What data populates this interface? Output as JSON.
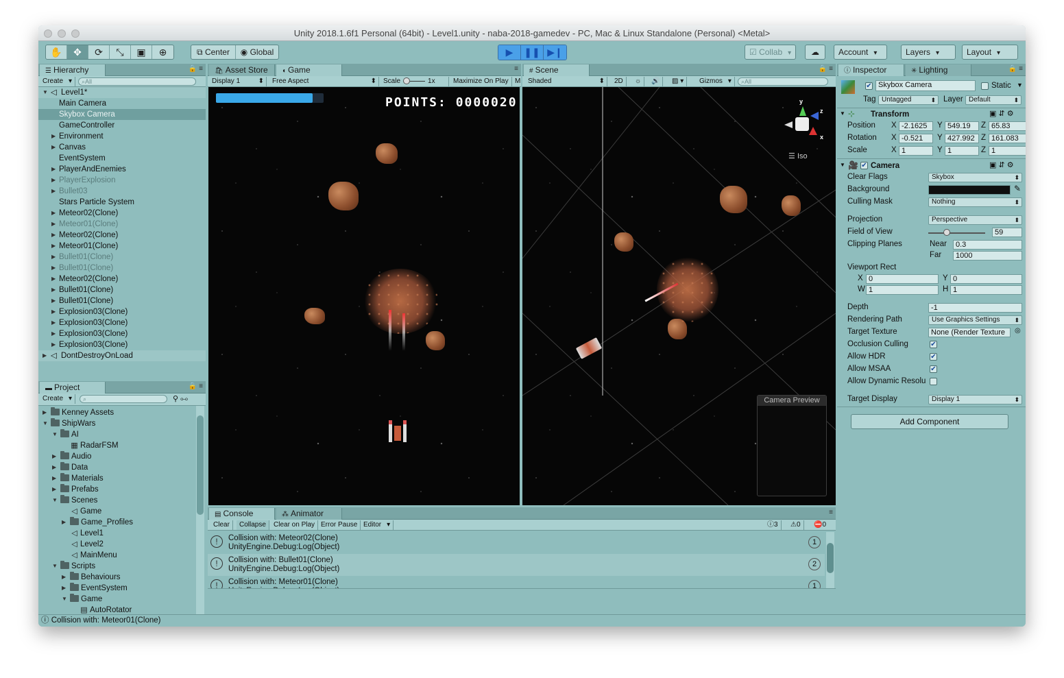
{
  "window": {
    "title": "Unity 2018.1.6f1 Personal (64bit) - Level1.unity - naba-2018-gamedev - PC, Mac & Linux Standalone (Personal) <Metal>"
  },
  "toolbar": {
    "pivot": "Center",
    "space": "Global",
    "collab": "Collab",
    "account": "Account",
    "layers": "Layers",
    "layout": "Layout"
  },
  "hierarchy": {
    "tab": "Hierarchy",
    "create": "Create",
    "search_placeholder": "All",
    "scene": "Level1*",
    "items": [
      "Main Camera",
      "Skybox Camera",
      "GameController",
      "Environment",
      "Canvas",
      "EventSystem",
      "PlayerAndEnemies",
      "PlayerExplosion",
      "Bullet03",
      "Stars Particle System",
      "Meteor02(Clone)",
      "Meteor01(Clone)",
      "Meteor02(Clone)",
      "Meteor01(Clone)",
      "Bullet01(Clone)",
      "Bullet01(Clone)",
      "Meteor02(Clone)",
      "Bullet01(Clone)",
      "Bullet01(Clone)",
      "Explosion03(Clone)",
      "Explosion03(Clone)",
      "Explosion03(Clone)",
      "Explosion03(Clone)"
    ],
    "dontdestroy": "DontDestroyOnLoad"
  },
  "project": {
    "tab": "Project",
    "create": "Create",
    "items": [
      "Kenney Assets",
      "ShipWars",
      "AI",
      "RadarFSM",
      "Audio",
      "Data",
      "Materials",
      "Prefabs",
      "Scenes",
      "Game",
      "Game_Profiles",
      "Level1",
      "Level2",
      "MainMenu",
      "Scripts",
      "Behaviours",
      "EventSystem",
      "Game",
      "AutoRotator"
    ]
  },
  "game": {
    "tabs": [
      "Asset Store",
      "Game"
    ],
    "display": "Display 1",
    "aspect": "Free Aspect",
    "scale_label": "Scale",
    "scale_value": "1x",
    "maximize": "Maximize On Play",
    "mute": "M",
    "points": "POINTS: 0000020",
    "health": 0.9
  },
  "scene": {
    "tab": "Scene",
    "shading": "Shaded",
    "mode2d": "2D",
    "gizmos": "Gizmos",
    "search_placeholder": "All",
    "iso": "Iso",
    "gizmo_y": "y",
    "gizmo_z": "z",
    "gizmo_x": "x",
    "camera_preview": "Camera Preview"
  },
  "console": {
    "tabs": [
      "Console",
      "Animator"
    ],
    "buttons": [
      "Clear",
      "Collapse",
      "Clear on Play",
      "Error Pause",
      "Editor"
    ],
    "counts": {
      "info": "3",
      "warn": "0",
      "error": "0"
    },
    "logs": [
      {
        "line1": "Collision with: Meteor02(Clone)",
        "line2": "UnityEngine.Debug:Log(Object)",
        "count": "1"
      },
      {
        "line1": "Collision with: Bullet01(Clone)",
        "line2": "UnityEngine.Debug:Log(Object)",
        "count": "2"
      },
      {
        "line1": "Collision with: Meteor01(Clone)",
        "line2": "UnityEngine.Debug:Log(Object)",
        "count": "1"
      }
    ]
  },
  "inspector": {
    "tabs": [
      "Inspector",
      "Lighting"
    ],
    "object_name": "Skybox Camera",
    "static": "Static",
    "tag_label": "Tag",
    "tag": "Untagged",
    "layer_label": "Layer",
    "layer": "Default",
    "transform": {
      "title": "Transform",
      "position": "Position",
      "rotation": "Rotation",
      "scale": "Scale",
      "pos": [
        "-2.1625",
        "549.19",
        "65.83"
      ],
      "rot": [
        "-0.521",
        "427.992",
        "161.083"
      ],
      "scl": [
        "1",
        "1",
        "1"
      ],
      "x": "X",
      "y": "Y",
      "z": "Z"
    },
    "camera": {
      "title": "Camera",
      "clear_flags": "Clear Flags",
      "clear_flags_val": "Skybox",
      "background": "Background",
      "culling_mask": "Culling Mask",
      "culling_mask_val": "Nothing",
      "projection": "Projection",
      "projection_val": "Perspective",
      "fov": "Field of View",
      "fov_val": "59",
      "clipping": "Clipping Planes",
      "near": "Near",
      "near_val": "0.3",
      "far": "Far",
      "far_val": "1000",
      "viewport": "Viewport Rect",
      "vx": "0",
      "vy": "0",
      "vw": "1",
      "vh": "1",
      "w": "W",
      "h": "H",
      "depth": "Depth",
      "depth_val": "-1",
      "render_path": "Rendering Path",
      "render_path_val": "Use Graphics Settings",
      "target_texture": "Target Texture",
      "target_texture_val": "None (Render Texture",
      "occlusion": "Occlusion Culling",
      "hdr": "Allow HDR",
      "msaa": "Allow MSAA",
      "dynres": "Allow Dynamic Resolu",
      "target_display": "Target Display",
      "target_display_val": "Display 1"
    },
    "add_component": "Add Component"
  },
  "statusbar": {
    "message": "Collision with: Meteor01(Clone)"
  }
}
